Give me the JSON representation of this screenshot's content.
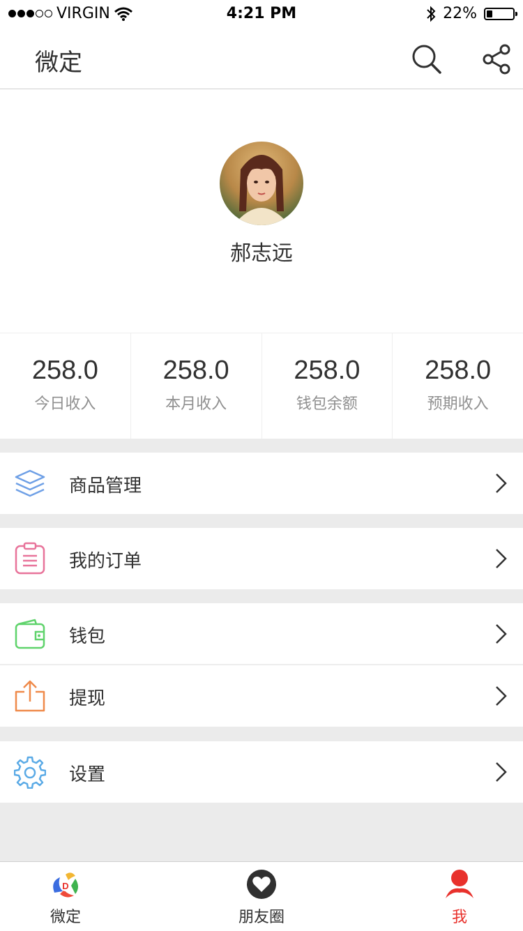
{
  "status_bar": {
    "carrier": "VIRGIN",
    "time": "4:21 PM",
    "battery": "22%",
    "battery_level": 0.22
  },
  "header": {
    "title": "微定"
  },
  "profile": {
    "name": "郝志远"
  },
  "stats": [
    {
      "value": "258.0",
      "label": "今日收入"
    },
    {
      "value": "258.0",
      "label": "本月收入"
    },
    {
      "value": "258.0",
      "label": "钱包余额"
    },
    {
      "value": "258.0",
      "label": "预期收入"
    }
  ],
  "menu": [
    {
      "label": "商品管理",
      "icon": "layers-icon",
      "color": "#6fa0e6"
    },
    {
      "label": "我的订单",
      "icon": "clipboard-icon",
      "color": "#e8739a"
    },
    {
      "label": "钱包",
      "icon": "wallet-icon",
      "color": "#5fd36b"
    },
    {
      "label": "提现",
      "icon": "upload-icon",
      "color": "#ef8a4a"
    },
    {
      "label": "设置",
      "icon": "gear-icon",
      "color": "#5aaae6"
    }
  ],
  "tabs": [
    {
      "label": "微定",
      "icon": "app-logo-icon"
    },
    {
      "label": "朋友圈",
      "icon": "heart-icon"
    },
    {
      "label": "我",
      "icon": "person-icon",
      "active": true
    }
  ],
  "colors": {
    "accent": "#e8312c",
    "text": "#303030",
    "subtext": "#909090",
    "background": "#ebebeb"
  }
}
